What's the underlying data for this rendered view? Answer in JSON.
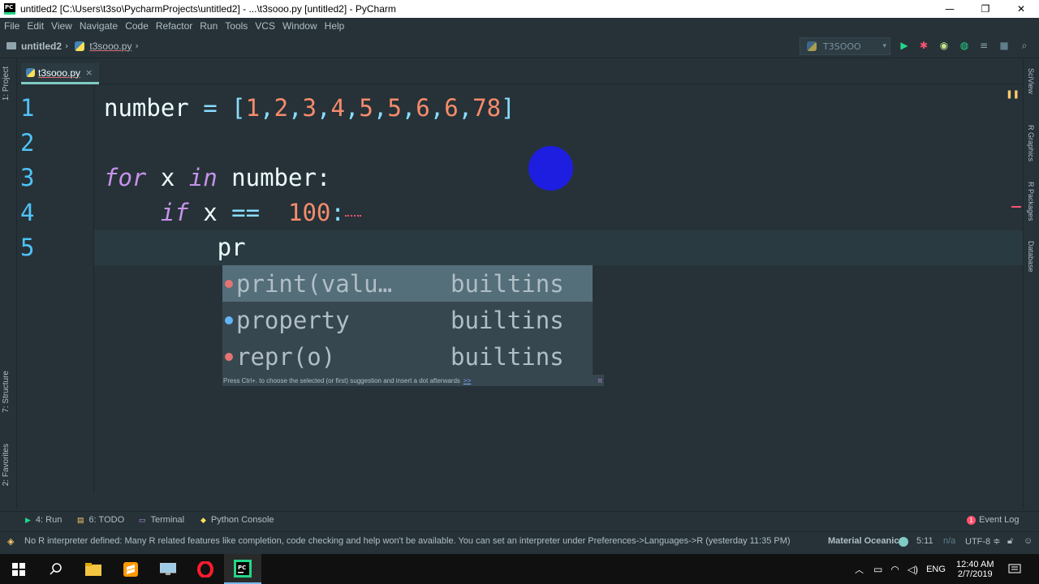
{
  "window": {
    "title": "untitled2 [C:\\Users\\t3so\\PycharmProjects\\untitled2] - ...\\t3sooo.py [untitled2] - PyCharm",
    "minimize": "—",
    "restore": "❐",
    "close": "✕"
  },
  "menu": [
    "File",
    "Edit",
    "View",
    "Navigate",
    "Code",
    "Refactor",
    "Run",
    "Tools",
    "VCS",
    "Window",
    "Help"
  ],
  "nav": {
    "project": "untitled2",
    "file": "t3sooo.py",
    "run_config": "T3SOOO"
  },
  "left_tools": {
    "project": "1: Project",
    "structure": "7: Structure",
    "favorites": "2: Favorites"
  },
  "right_tools": [
    "SciView",
    "R Graphics",
    "R Packages",
    "Database"
  ],
  "tab": {
    "label": "t3sooo.py",
    "close": "×"
  },
  "editor": {
    "line_numbers": [
      "1",
      "2",
      "3",
      "4",
      "5"
    ],
    "line1": {
      "name": "number",
      "eq": " = ",
      "open": "[",
      "items": [
        "1",
        "2",
        "3",
        "4",
        "5",
        "5",
        "6",
        "6",
        "78"
      ],
      "close": "]"
    },
    "line3": {
      "kw1": "for",
      "var": " x ",
      "kw2": "in",
      "rest": " number:"
    },
    "line4": {
      "indent": "    ",
      "kw": "if",
      "var": " x ",
      "op": "==",
      "space": "  ",
      "num": "100",
      "colon": ":"
    },
    "line5": {
      "text": "        pr"
    }
  },
  "completion": {
    "items": [
      {
        "name": "print(valu…",
        "type": "builtins",
        "icon_color": "#e57373"
      },
      {
        "name": "property",
        "type": "builtins",
        "icon_color": "#64b5f6"
      },
      {
        "name": "repr(o)",
        "type": "builtins",
        "icon_color": "#e57373"
      }
    ],
    "hint": "Press Ctrl+. to choose the selected (or first) suggestion and insert a dot afterwards",
    "hint_more": ">>"
  },
  "bottom_tools": {
    "run": "4: Run",
    "todo": "6: TODO",
    "terminal": "Terminal",
    "python_console": "Python Console",
    "event_log": "Event Log",
    "event_count": "1"
  },
  "status": {
    "message": "No R interpreter defined: Many R related features like completion, code checking and help won't be available. You can set an interpreter under Preferences->Languages->R (yesterday 11:35 PM)",
    "theme": "Material Oceanic",
    "position": "5:11",
    "na": "n/a",
    "encoding": "UTF-8 ≑"
  },
  "taskbar": {
    "time": "12:40 AM",
    "date": "2/7/2019",
    "lang": "ENG"
  },
  "colors": {
    "accent": "#80cbc4",
    "background": "#263238",
    "keyword": "#c792ea",
    "number": "#f78c6c",
    "line_number": "#4fc3f7"
  }
}
